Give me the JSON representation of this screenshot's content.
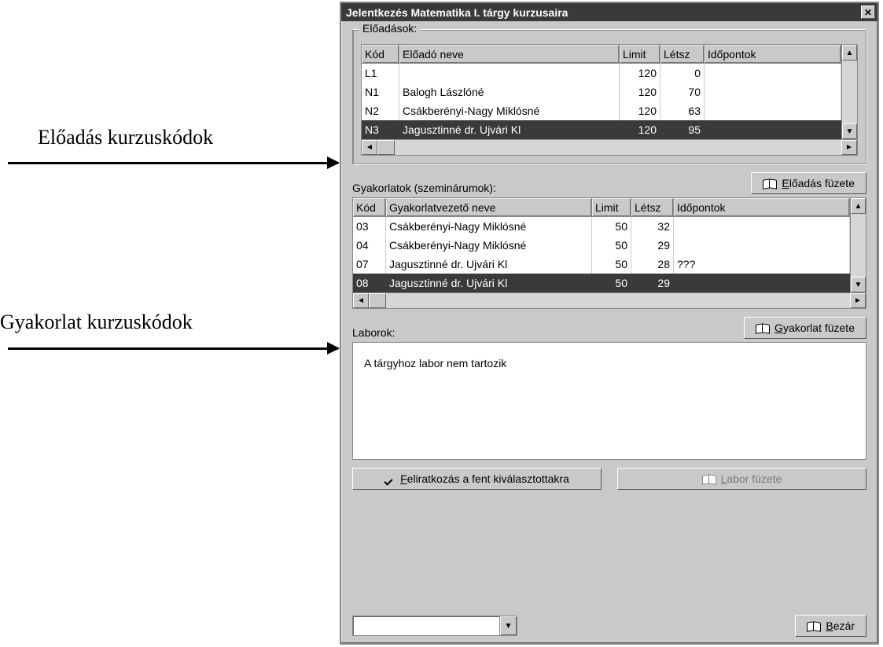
{
  "annotations": {
    "lecture_codes": "Előadás kurzuskódok",
    "practice_codes": "Gyakorlat kurzuskódok"
  },
  "window": {
    "title": "Jelentkezés Matematika I. tárgy kurzusaira"
  },
  "lectures": {
    "group_label": "Előadások:",
    "columns": {
      "kod": "Kód",
      "nev": "Előadó neve",
      "limit": "Limit",
      "letsz": "Létsz",
      "ido": "Időpontok"
    },
    "rows": [
      {
        "kod": "L1",
        "nev": "",
        "limit": "120",
        "letsz": "0",
        "ido": "",
        "selected": false
      },
      {
        "kod": "N1",
        "nev": "Balogh Lászlóné",
        "limit": "120",
        "letsz": "70",
        "ido": "",
        "selected": false
      },
      {
        "kod": "N2",
        "nev": "Csákberényi-Nagy Miklósné",
        "limit": "120",
        "letsz": "63",
        "ido": "",
        "selected": false
      },
      {
        "kod": "N3",
        "nev": "Jagusztinné dr. Ujvári Kl",
        "limit": "120",
        "letsz": "95",
        "ido": "",
        "selected": true
      }
    ]
  },
  "practices": {
    "section_label": "Gyakorlatok (szeminárumok):",
    "columns": {
      "kod": "Kód",
      "nev": "Gyakorlatvezető neve",
      "limit": "Limit",
      "letsz": "Létsz",
      "ido": "Időpontok"
    },
    "rows": [
      {
        "kod": "03",
        "nev": "Csákberényi-Nagy Miklósné",
        "limit": "50",
        "letsz": "32",
        "ido": "",
        "selected": false
      },
      {
        "kod": "04",
        "nev": "Csákberényi-Nagy Miklósné",
        "limit": "50",
        "letsz": "29",
        "ido": "",
        "selected": false
      },
      {
        "kod": "07",
        "nev": "Jagusztinné dr. Ujvári Kl",
        "limit": "50",
        "letsz": "28",
        "ido": "???",
        "selected": false
      },
      {
        "kod": "08",
        "nev": "Jagusztinné dr. Ujvári Kl",
        "limit": "50",
        "letsz": "29",
        "ido": "",
        "selected": true
      }
    ]
  },
  "labs": {
    "section_label": "Laborok:",
    "empty_text": "A tárgyhoz labor nem tartozik"
  },
  "buttons": {
    "lecture_notes": {
      "prefix": "E",
      "rest": "lőadás füzete"
    },
    "practice_notes": {
      "prefix": "G",
      "rest": "yakorlat füzete"
    },
    "lab_notes": {
      "prefix": "L",
      "rest": "abor füzete"
    },
    "subscribe": {
      "prefix": "F",
      "rest": "eliratkozás a fent kiválasztottakra"
    },
    "close": {
      "prefix": "B",
      "rest": "ezár"
    }
  },
  "status_combo_value": ""
}
